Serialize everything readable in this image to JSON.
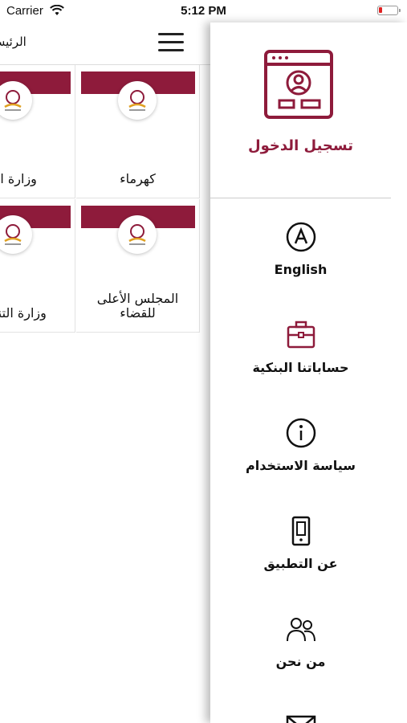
{
  "status_bar": {
    "carrier": "Carrier",
    "time": "5:12 PM"
  },
  "main": {
    "title": "الرئيس",
    "tiles": [
      {
        "name": "كهرماء"
      },
      {
        "name": "وزارة الد"
      },
      {
        "name": "المجلس الأعلى للقضاء"
      },
      {
        "name": "وزارة التنمية"
      }
    ]
  },
  "drawer": {
    "login_label": "تسجيل الدخول",
    "items": [
      {
        "label": "English",
        "icon": "language-a-icon"
      },
      {
        "label": "حساباتنا البنكية",
        "icon": "briefcase-icon"
      },
      {
        "label": "سياسة الاستخدام",
        "icon": "info-icon"
      },
      {
        "label": "عن التطبيق",
        "icon": "mobile-icon"
      },
      {
        "label": "من نحن",
        "icon": "users-icon"
      },
      {
        "label": "",
        "icon": "mail-icon"
      }
    ]
  },
  "colors": {
    "brand": "#8e1b3b",
    "battery_low": "#e02020"
  }
}
